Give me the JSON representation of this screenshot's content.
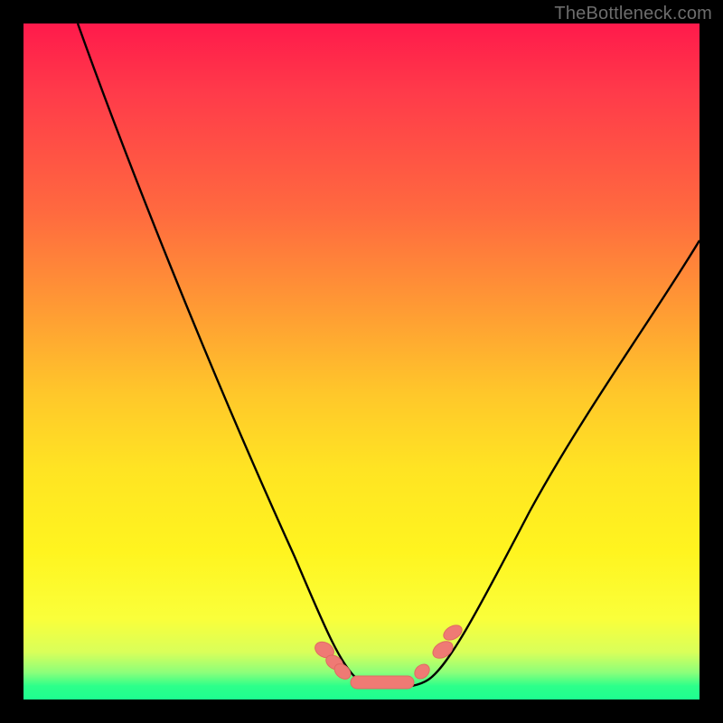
{
  "watermark": "TheBottleneck.com",
  "colors": {
    "frame": "#000000",
    "curve": "#000000",
    "marker_fill": "#ef7a74",
    "marker_stroke": "#e06a62"
  },
  "chart_data": {
    "type": "line",
    "title": "",
    "xlabel": "",
    "ylabel": "",
    "xlim": [
      0,
      100
    ],
    "ylim": [
      0,
      100
    ],
    "series": [
      {
        "name": "left-branch",
        "x": [
          8,
          12,
          17,
          23,
          30,
          37,
          41,
          44,
          46
        ],
        "values": [
          100,
          88,
          74,
          58,
          40,
          22,
          12,
          7,
          4
        ]
      },
      {
        "name": "floor",
        "x": [
          46,
          49,
          52,
          55,
          58,
          61
        ],
        "values": [
          4,
          1.7,
          1.5,
          1.5,
          1.7,
          4
        ]
      },
      {
        "name": "right-branch",
        "x": [
          61,
          64,
          68,
          74,
          82,
          90,
          100
        ],
        "values": [
          4,
          8,
          14,
          24,
          38,
          52,
          70
        ]
      }
    ],
    "markers": {
      "name": "floor-markers",
      "points": [
        {
          "x": 44.5,
          "y": 6.0
        },
        {
          "x": 46.0,
          "y": 4.2
        },
        {
          "x": 47.2,
          "y": 2.8
        },
        {
          "x": 50.0,
          "y": 1.6
        },
        {
          "x": 53.5,
          "y": 1.5
        },
        {
          "x": 57.0,
          "y": 1.6
        },
        {
          "x": 59.0,
          "y": 2.6
        },
        {
          "x": 62.0,
          "y": 6.0
        },
        {
          "x": 63.5,
          "y": 8.5
        }
      ]
    }
  }
}
